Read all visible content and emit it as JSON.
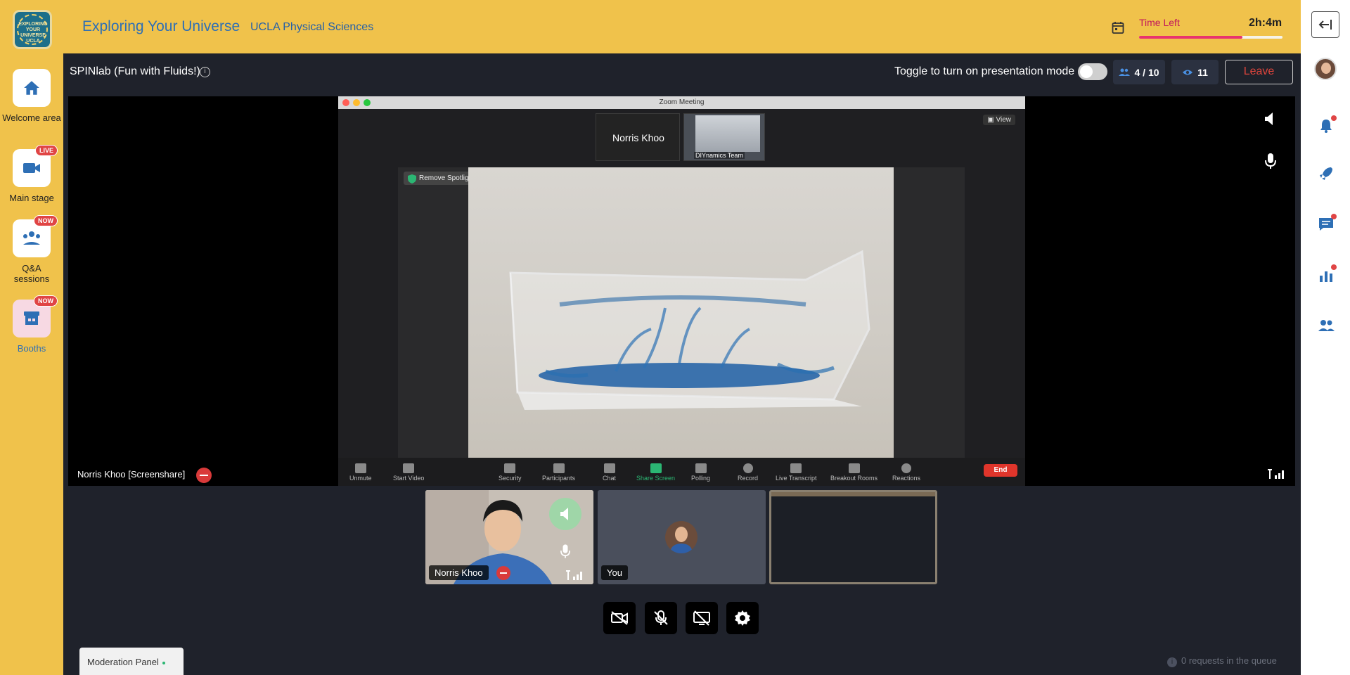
{
  "sidebar": {
    "logo_text": "EXPLORING YOUR UNIVERSE UCLA",
    "items": [
      {
        "label": "Welcome area",
        "icon": "home-icon"
      },
      {
        "label": "Main stage",
        "icon": "video-camera-icon",
        "badge": "LIVE"
      },
      {
        "label": "Q&A sessions",
        "icon": "audience-icon",
        "badge": "NOW"
      },
      {
        "label": "Booths",
        "icon": "booth-icon",
        "badge": "NOW"
      }
    ]
  },
  "header": {
    "event_title": "Exploring Your Universe",
    "organization": "UCLA Physical Sciences",
    "time_left_label": "Time Left",
    "time_left_value": "2h:4m",
    "time_left_fraction": 0.72
  },
  "session": {
    "title": "SPINlab (Fun with Fluids!)",
    "presentation_toggle_label": "Toggle to turn on presentation mode",
    "presentation_mode_on": false,
    "participants": "4 / 10",
    "viewers": "11",
    "leave_label": "Leave"
  },
  "stage": {
    "zoom_window_title": "Zoom Meeting",
    "thumbnails": [
      {
        "name": "Norris Khoo"
      },
      {
        "name": "DIYnamics Team"
      }
    ],
    "view_label": "View",
    "remove_spotlight_label": "Remove Spotlight",
    "zoom_toolbar": [
      "Unmute",
      "Start Video",
      "Security",
      "Participants",
      "Chat",
      "Share Screen",
      "Polling",
      "Record",
      "Live Transcript",
      "Breakout Rooms",
      "Reactions"
    ],
    "end_label": "End",
    "screenshare_label": "Norris Khoo [Screenshare]"
  },
  "participants": [
    {
      "name": "Norris Khoo"
    },
    {
      "name": "You"
    },
    {
      "name": ""
    }
  ],
  "controls": [
    "camera-off-icon",
    "mic-off-icon",
    "screenshare-off-icon",
    "settings-icon"
  ],
  "footer": {
    "moderation_panel_label": "Moderation Panel",
    "queue_text": "0 requests in the queue"
  },
  "colors": {
    "brand_yellow": "#f0c24b",
    "brand_blue": "#2e6fb5",
    "dark_bg": "#1f222b",
    "leave_red": "#e0453c",
    "progress_pink": "#e8336e"
  }
}
